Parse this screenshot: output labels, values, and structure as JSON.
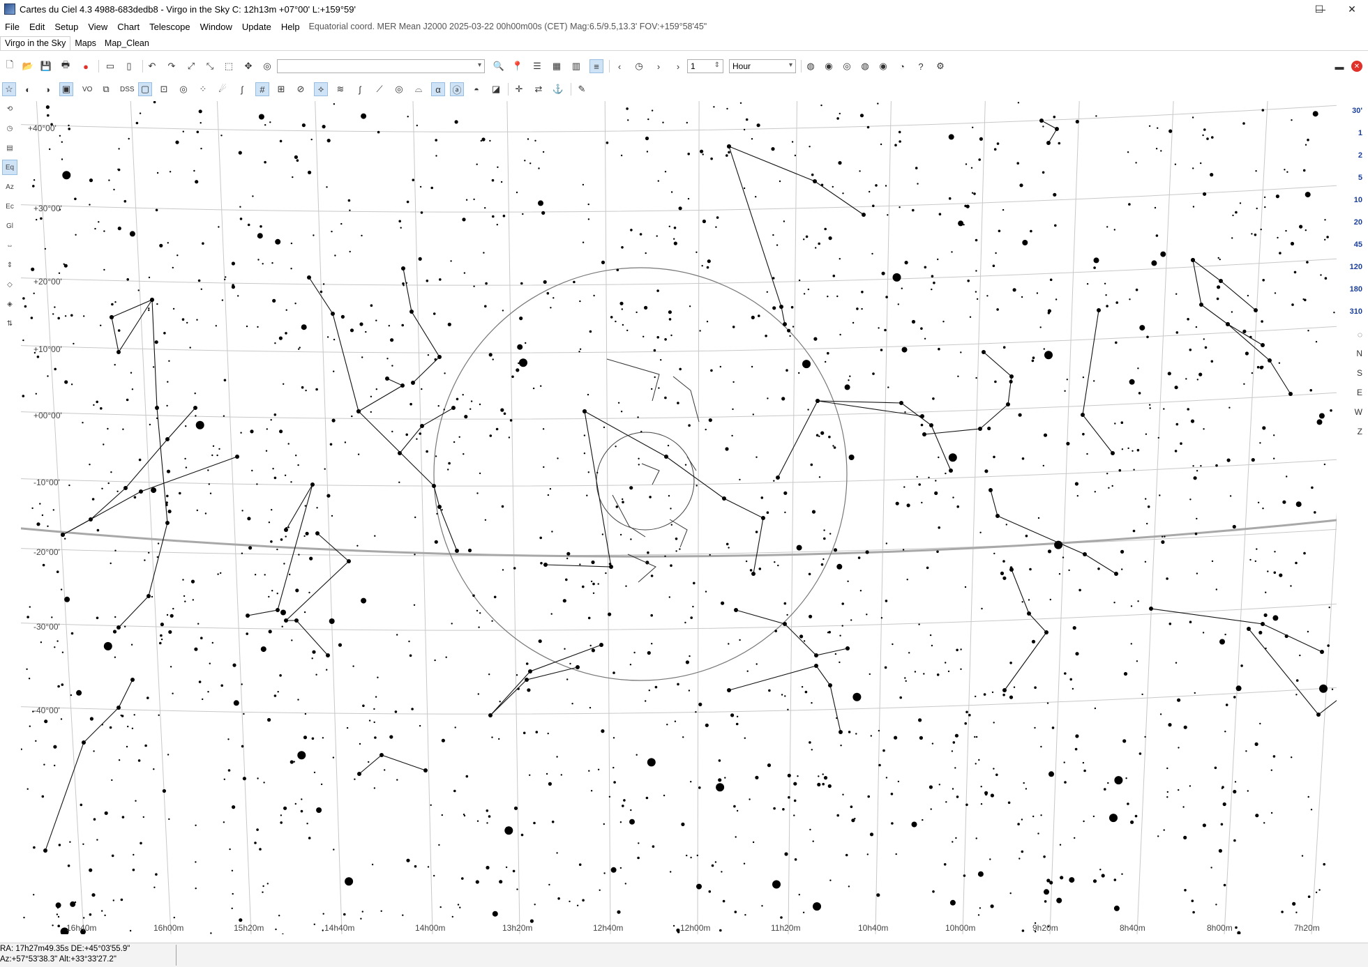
{
  "window": {
    "title": "Cartes du Ciel 4.3 4988-683dedb8 - Virgo in the Sky  C: 12h13m +07°00' L:+159°59'",
    "minimize_glyph": "—",
    "maximize_glyph": "☐",
    "close_glyph": "✕"
  },
  "menu": {
    "items": [
      "File",
      "Edit",
      "Setup",
      "View",
      "Chart",
      "Telescope",
      "Window",
      "Update",
      "Help"
    ],
    "status": "Equatorial coord. MER Mean J2000 2025-03-22 00h00m00s (CET) Mag:6.5/9.5,13.3' FOV:+159°58'45\""
  },
  "tabs": [
    "Virgo in the Sky",
    "Maps",
    "Map_Clean"
  ],
  "toolbar": {
    "search_value": "",
    "step_value": "1",
    "step_unit": "Hour"
  },
  "toolbar2_labels": {
    "vo": "VO",
    "dss": "DSS",
    "alpha": "α"
  },
  "left_tools": [
    "⟲",
    "◷",
    "▤",
    "Eq",
    "Az",
    "Ec",
    "Gl",
    "⇔",
    "⇕",
    "◇",
    "◈",
    "⇅"
  ],
  "fov_scale": [
    "30'",
    "1",
    "2",
    "5",
    "10",
    "20",
    "45",
    "120",
    "180",
    "310"
  ],
  "orient": [
    "N",
    "S",
    "E",
    "W",
    "Z"
  ],
  "status": {
    "radec": "RA: 17h27m49.35s DE:+45°03'55.9\"",
    "altaz": "Az:+57°53'38.3\" Alt:+33°33'27.2\""
  },
  "chart_grid": {
    "dec_labels": [
      "+40°00'",
      "+30°00'",
      "+20°00'",
      "+10°00'",
      "+00°00'",
      "-10°00'",
      "-20°00'",
      "-30°00'",
      "-40°00'"
    ],
    "ra_labels": [
      "16h40m",
      "16h00m",
      "15h20m",
      "14h40m",
      "14h00m",
      "13h20m",
      "12h40m",
      "12h00m",
      "11h20m",
      "10h40m",
      "10h00m",
      "9h20m",
      "8h40m",
      "8h00m",
      "7h20m"
    ]
  },
  "colors": {
    "accent": "#1a3e9b",
    "active_tool": "#cfe3f7",
    "close_red": "#e0312b"
  }
}
